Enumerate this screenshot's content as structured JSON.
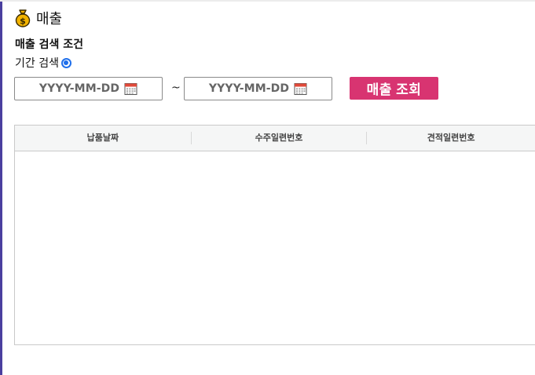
{
  "page": {
    "title": "매출",
    "icon": "money-bag-icon"
  },
  "search_conditions": {
    "heading": "매출 검색 조건",
    "period_label": "기간 검색",
    "period_radio_selected": true,
    "start_date_placeholder": "YYYY-MM-DD",
    "end_date_placeholder": "YYYY-MM-DD",
    "range_separator": "~",
    "calendar_icon": "calendar-icon",
    "search_button_label": "매출 조회"
  },
  "grid": {
    "columns": [
      "납품날짜",
      "수주일련번호",
      "견적일련번호"
    ],
    "rows": []
  },
  "colors": {
    "accent": "#d83471",
    "radio": "#1f6feb",
    "left_border": "#4a3f9f"
  }
}
